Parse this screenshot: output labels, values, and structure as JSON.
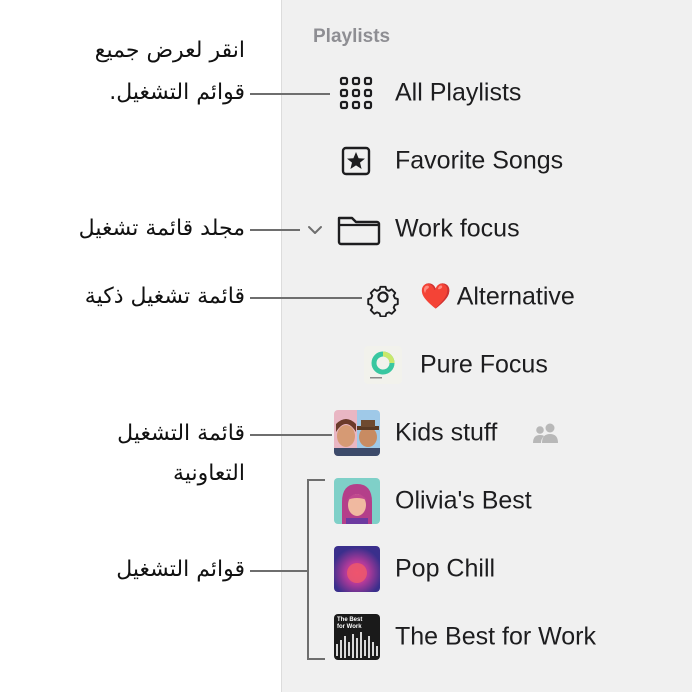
{
  "sidebar": {
    "section_title": "Playlists",
    "items": [
      {
        "label": "All Playlists",
        "icon": "grid-icon"
      },
      {
        "label": "Favorite Songs",
        "icon": "star-square-icon"
      },
      {
        "label": "Work focus",
        "icon": "folder-icon"
      },
      {
        "label": "❤️ Alternative",
        "icon": "gear-icon"
      },
      {
        "label": "Pure Focus",
        "icon": "pure-focus-artwork"
      },
      {
        "label": "Kids stuff",
        "icon": "kids-stuff-artwork",
        "badge": "people-icon"
      },
      {
        "label": "Olivia's Best",
        "icon": "olivia-artwork"
      },
      {
        "label": "Pop Chill",
        "icon": "pop-chill-artwork"
      },
      {
        "label": "The Best for Work",
        "icon": "best-for-work-artwork",
        "artwork_text": "The Best for Work"
      }
    ]
  },
  "callouts": {
    "all_playlists_line1": "انقر لعرض جميع",
    "all_playlists_line2": "قوائم التشغيل.",
    "folder": "مجلد قائمة تشغيل",
    "smart": "قائمة تشغيل ذكية",
    "collab_line1": "قائمة التشغيل",
    "collab_line2": "التعاونية",
    "playlists": "قوائم التشغيل"
  },
  "colors": {
    "sidebar_bg": "#f0f0f0",
    "section_title": "#8e8e93",
    "text": "#1d1d1f"
  }
}
